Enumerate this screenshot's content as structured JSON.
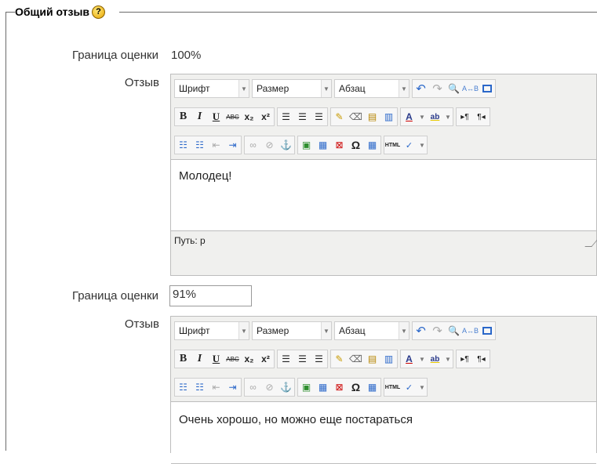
{
  "fieldset": {
    "legend": "Общий отзыв",
    "help_icon": "help-icon"
  },
  "rows": [
    {
      "boundary_label": "Граница оценки",
      "boundary_value": "100%",
      "feedback_label": "Отзыв",
      "editor": {
        "font": "Шрифт",
        "size": "Размер",
        "format": "Абзац",
        "content": "Молодец!",
        "path": "Путь: p"
      }
    },
    {
      "boundary_label": "Граница оценки",
      "boundary_value": "91%",
      "feedback_label": "Отзыв",
      "editor": {
        "font": "Шрифт",
        "size": "Размер",
        "format": "Абзац",
        "content": "Очень хорошо, но можно еще постараться"
      }
    }
  ],
  "toolbar": {
    "row2_text": [
      "B",
      "I",
      "U",
      "ABC",
      "x₂",
      "x²"
    ],
    "html_label": "HTML",
    "icons": [
      "undo-icon",
      "redo-icon",
      "find-icon",
      "replace-icon",
      "fullscreen-icon",
      "align-left-icon",
      "align-center-icon",
      "align-right-icon",
      "cleanup-icon",
      "eraser-icon",
      "paste-text-icon",
      "paste-word-icon",
      "text-color-icon",
      "highlight-icon",
      "ltr-icon",
      "rtl-icon",
      "bullet-list-icon",
      "numbered-list-icon",
      "outdent-icon",
      "indent-icon",
      "link-icon",
      "unlink-icon",
      "anchor-icon",
      "image-icon",
      "media-icon",
      "nolink-icon",
      "special-char-icon",
      "table-icon",
      "html-icon",
      "spellcheck-icon"
    ]
  },
  "colors": {
    "border": "#bdbdbd",
    "toolbar_bg": "#f0f0ee",
    "help_yellow": "#f5c400"
  }
}
